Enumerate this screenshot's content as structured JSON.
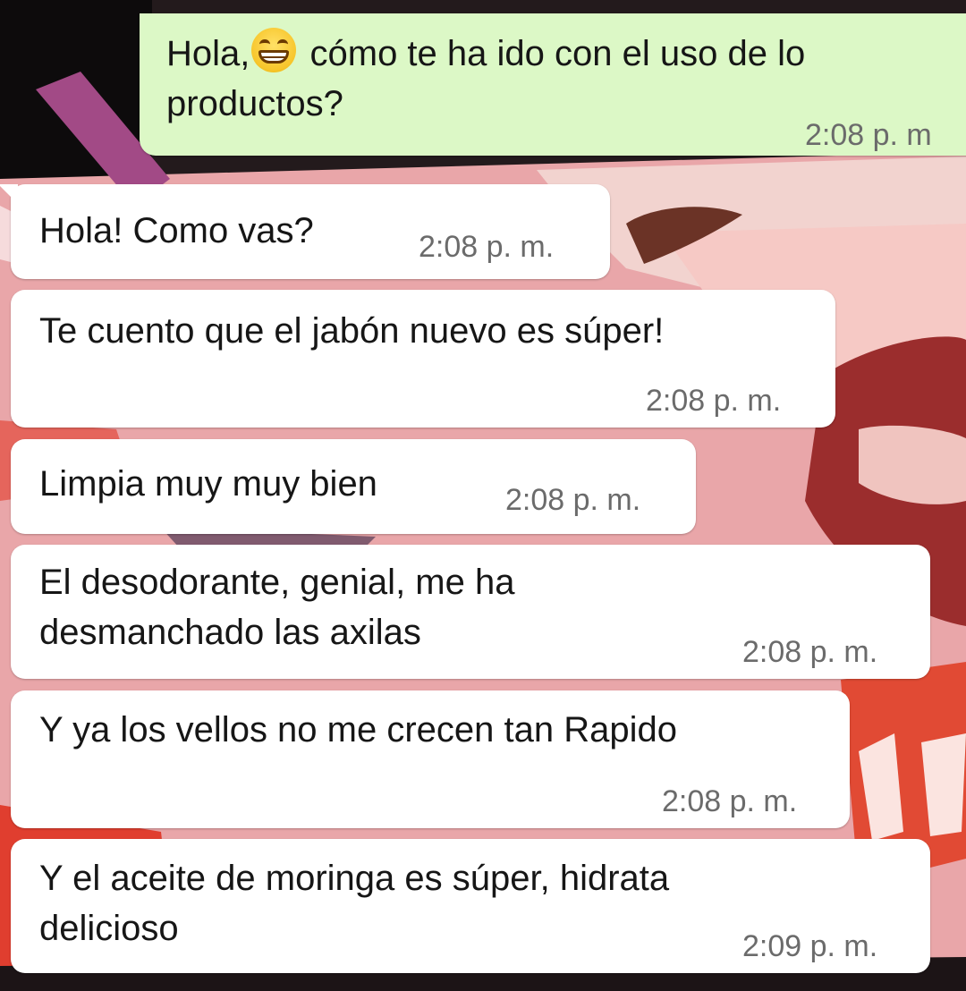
{
  "colors": {
    "outgoing_bubble": "#dcf8c6",
    "incoming_bubble": "#ffffff",
    "timestamp": "#6b6b6b"
  },
  "outgoing": {
    "text_before_emoji": "Hola,",
    "emoji": "grinning-face-emoji",
    "text_after_emoji": " cómo te ha ido con el uso de lo",
    "text_line2": "productos?",
    "time": "2:08 p. m"
  },
  "messages": [
    {
      "text": "Hola! Como vas?",
      "time": "2:08 p. m."
    },
    {
      "text": "Te cuento que el jabón nuevo es súper!",
      "time": "2:08 p. m."
    },
    {
      "text": "Limpia muy muy bien",
      "time": "2:08 p. m."
    },
    {
      "text": "El desodorante, genial, me ha\ndesmanchado las axilas",
      "time": "2:08 p. m."
    },
    {
      "text": "Y ya los vellos no me crecen tan Rapido",
      "time": "2:08 p. m."
    },
    {
      "text": "Y el aceite de moringa es súper, hidrata\ndelicioso",
      "time": "2:09 p. m."
    }
  ]
}
